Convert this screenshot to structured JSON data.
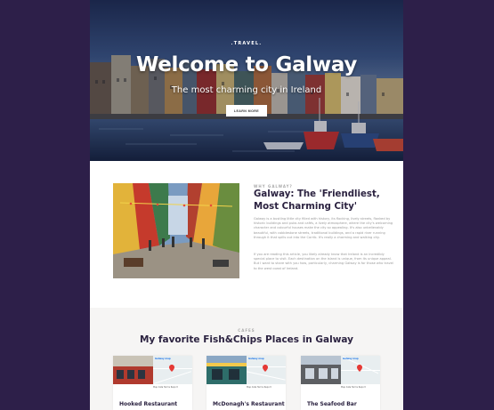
{
  "hero": {
    "brand": ".TRAVEL.",
    "title": "Welcome to Galway",
    "subtitle": "The most charming city in Ireland",
    "button": "LEARN MORE"
  },
  "about": {
    "kicker": "WHY GALWAY?",
    "title": "Galway: The 'Friendliest, Most Charming City'",
    "p1": "Galway is a bustling little city filled with history, its flocking, lively streets, flanked by historic buildings and pubs and cafés, a lively atmosphere, where the city's welcoming character and colourful houses make the city so appealing. It's also unbelievably beautiful, with cobblestone streets, traditional buildings, and a rapid river running through it that spills out into the Corrib. It's really a charming and walking city.",
    "p2": "If you are reading this article, you likely already know that Ireland is an incredibly special place to visit. Each destination on the island is unique, from its unique appeal. But I want to share with you how, particularly, charming Galway is for those who travel to the west coast of Ireland."
  },
  "cafes": {
    "kicker": "CAFES",
    "title": "My favorite Fish&Chips Places in Galway",
    "map_label": "Galway map",
    "map_footer": "Map data  Terms  Report",
    "items": [
      {
        "name": "Hooked Restaurant"
      },
      {
        "name": "McDonagh's Restaurant"
      },
      {
        "name": "The Seafood Bar"
      }
    ]
  }
}
